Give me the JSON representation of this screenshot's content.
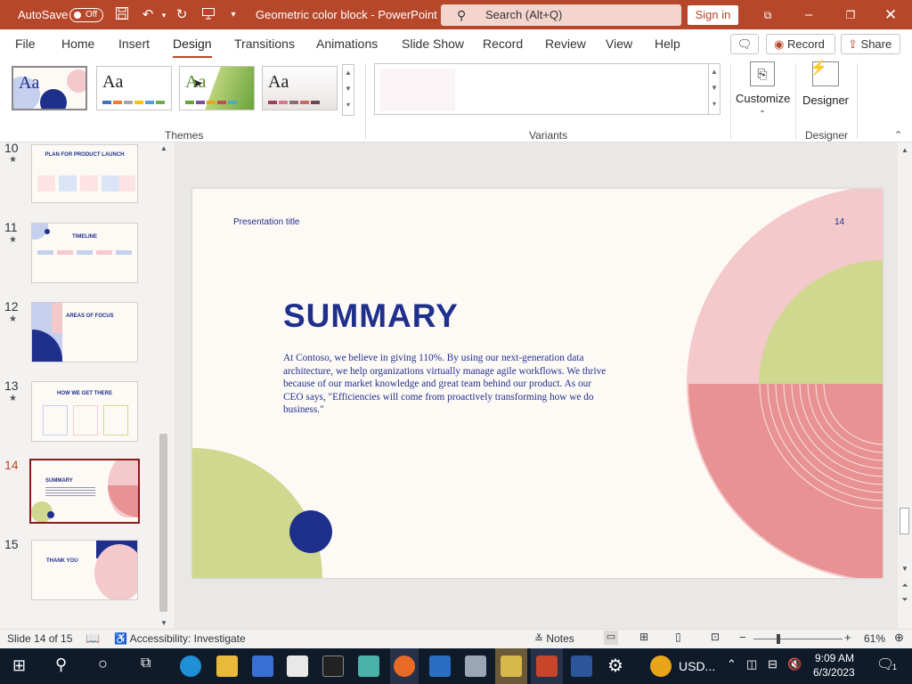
{
  "titlebar": {
    "autosave_label": "AutoSave",
    "autosave_state": "Off",
    "doc_title": "Geometric color block",
    "app_name": "PowerPoint",
    "separator": "-",
    "search_placeholder": "Search (Alt+Q)",
    "signin_label": "Sign in"
  },
  "ribbon": {
    "tabs": [
      "File",
      "Home",
      "Insert",
      "Design",
      "Transitions",
      "Animations",
      "Slide Show",
      "Record",
      "Review",
      "View",
      "Help"
    ],
    "selected_tab": "Design",
    "record_label": "Record",
    "share_label": "Share",
    "groups": {
      "themes": "Themes",
      "variants": "Variants",
      "designer": "Designer"
    },
    "customize_label": "Customize",
    "designer_label": "Designer",
    "theme_sample": "Aa"
  },
  "thumbnails": [
    {
      "num": "10",
      "title": "PLAN FOR PRODUCT LAUNCH"
    },
    {
      "num": "11",
      "title": "TIMELINE"
    },
    {
      "num": "12",
      "title": "AREAS OF FOCUS"
    },
    {
      "num": "13",
      "title": "HOW WE GET THERE"
    },
    {
      "num": "14",
      "title": "SUMMARY"
    },
    {
      "num": "15",
      "title": "THANK YOU"
    }
  ],
  "slide": {
    "presentation_title": "Presentation title",
    "page_number": "14",
    "heading": "SUMMARY",
    "body": "At Contoso, we believe in giving 110%. By using our next-generation data architecture, we help organizations virtually manage agile workflows. We thrive because of our market knowledge and great team behind our product. As our CEO says, \"Efficiencies will come from proactively transforming how we do business.\""
  },
  "status": {
    "slide_info": "Slide 14 of 15",
    "accessibility": "Accessibility: Investigate",
    "notes_label": "Notes",
    "zoom": "61%"
  },
  "taskbar": {
    "usd_label": "USD...",
    "time": "9:09 AM",
    "date": "6/3/2023",
    "notification_count": "1"
  },
  "colors": {
    "accent": "#b7472a",
    "navy": "#1f2f8c",
    "pink": "#f4c9cc",
    "green": "#cfd88e",
    "salmon": "#e89293"
  }
}
